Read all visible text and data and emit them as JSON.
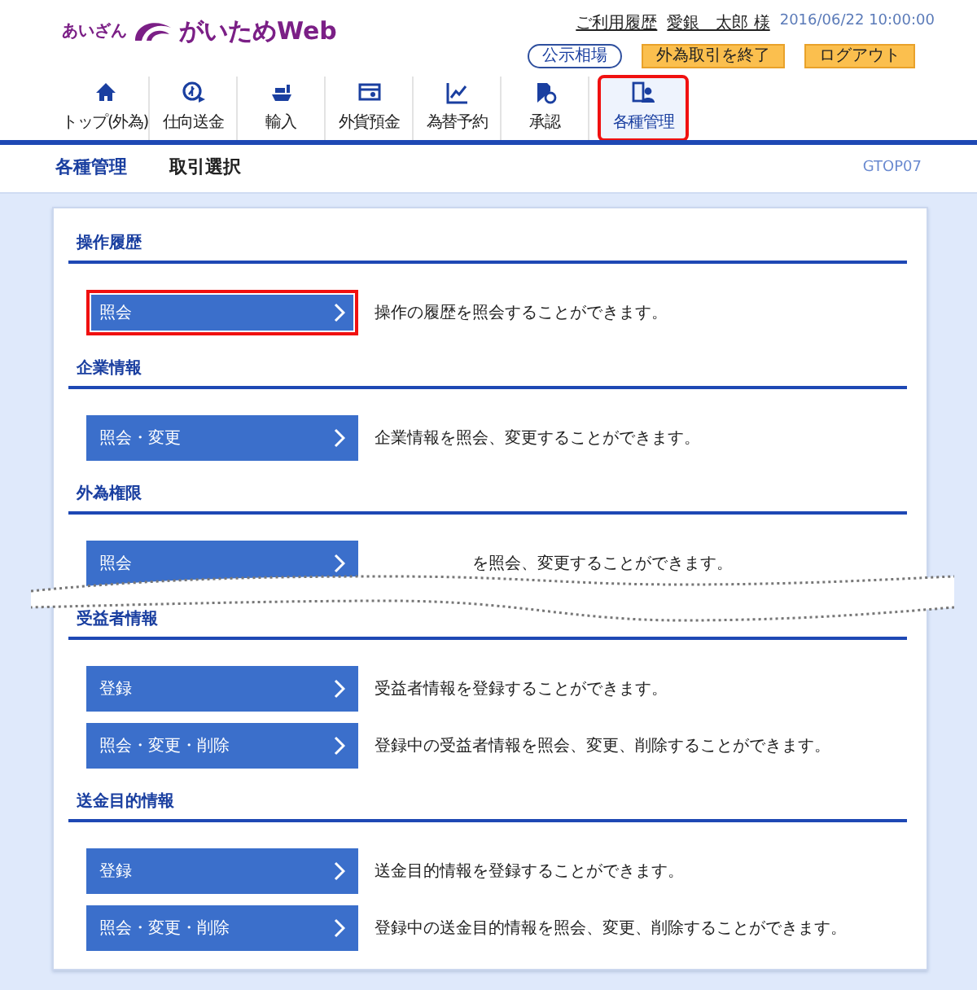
{
  "header": {
    "logo_small": "あいざん",
    "logo_main": "がいためWeb",
    "links": [
      {
        "label": "ご利用履歴"
      },
      {
        "label": "愛銀　太郎 様"
      }
    ],
    "datetime": "2016/06/22 10:00:00",
    "buttons": [
      {
        "label": "公示相場",
        "kind": "outline"
      },
      {
        "label": "外為取引を終了",
        "kind": "orange"
      },
      {
        "label": "ログアウト",
        "kind": "orange"
      }
    ]
  },
  "tabs": [
    {
      "label": "トップ(外為)",
      "selected": false,
      "highlighted": false
    },
    {
      "label": "仕向送金",
      "selected": false,
      "highlighted": false
    },
    {
      "label": "輸入",
      "selected": false,
      "highlighted": false
    },
    {
      "label": "外貨預金",
      "selected": false,
      "highlighted": false
    },
    {
      "label": "為替予約",
      "selected": false,
      "highlighted": false
    },
    {
      "label": "承認",
      "selected": false,
      "highlighted": false
    },
    {
      "label": "各種管理",
      "selected": true,
      "highlighted": true
    }
  ],
  "subheader": {
    "title": "各種管理",
    "subtitle": "取引選択",
    "screen_id": "GTOP07"
  },
  "sections": [
    {
      "title": "操作履歴",
      "cut": false,
      "actions": [
        {
          "label": "照会",
          "description": "操作の履歴を照会することができます。",
          "highlighted": true
        }
      ]
    },
    {
      "title": "企業情報",
      "cut": false,
      "actions": [
        {
          "label": "照会・変更",
          "description": "企業情報を照会、変更することができます。",
          "highlighted": false
        }
      ]
    },
    {
      "title": "外為権限",
      "cut": true,
      "actions": [
        {
          "label": "照会",
          "description": "を照会、変更することができます。",
          "highlighted": false
        }
      ]
    },
    {
      "title": "受益者情報",
      "cut": false,
      "actions": [
        {
          "label": "登録",
          "description": "受益者情報を登録することができます。",
          "highlighted": false
        },
        {
          "label": "照会・変更・削除",
          "description": "登録中の受益者情報を照会、変更、削除することができます。",
          "highlighted": false
        }
      ]
    },
    {
      "title": "送金目的情報",
      "cut": false,
      "actions": [
        {
          "label": "登録",
          "description": "送金目的情報を登録することができます。",
          "highlighted": false
        },
        {
          "label": "照会・変更・削除",
          "description": "登録中の送金目的情報を照会、変更、削除することができます。",
          "highlighted": false
        }
      ]
    }
  ]
}
